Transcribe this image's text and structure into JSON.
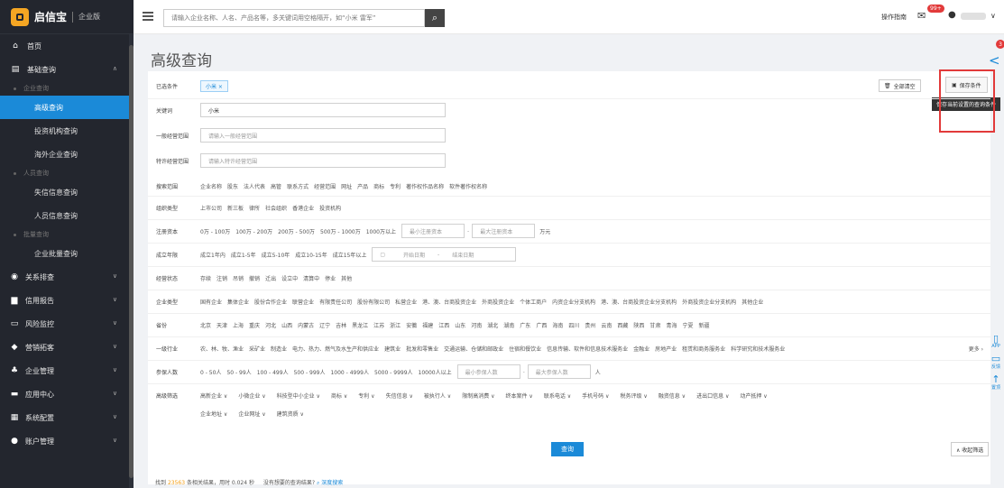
{
  "sidebar": {
    "logo_text": "启信宝",
    "logo_sub": "企业版",
    "home": "首页",
    "basic_query": "基础查询",
    "group_enterprise": "企业查询",
    "advanced_query": "高级查询",
    "investor_query": "投资机构查询",
    "overseas_query": "海外企业查询",
    "group_person": "人员查询",
    "dishonest_query": "失信信息查询",
    "person_query": "人员信息查询",
    "group_batch": "批量查询",
    "batch_query": "企业批量查询",
    "relation": "关系排查",
    "credit_report": "信用报告",
    "risk_monitor": "风险监控",
    "marketing": "营销拓客",
    "enterprise_manage": "企业管理",
    "app_center": "应用中心",
    "system_config": "系统配置",
    "account_manage": "账户管理"
  },
  "topbar": {
    "search_placeholder": "请输入企业名称、人名、产品名等，多关键词用空格隔开，如“小米 雷军”",
    "guide": "操作指南",
    "mail_badge": "99+"
  },
  "page": {
    "title": "高级查询",
    "share_badge": "3"
  },
  "form": {
    "selected_label": "已选条件",
    "selected_chip": "小米 ×",
    "clear_label": "全部清空",
    "save_label": "保存条件",
    "tooltip": "保存当前设置的查询条件",
    "keyword_label": "关键词",
    "keyword_value": "小米",
    "general_scope_label": "一般经营范围",
    "general_scope_placeholder": "请输入一般经营范围",
    "licensed_scope_label": "特许经营范围",
    "licensed_scope_placeholder": "请输入特许经营范围",
    "search_range_label": "搜索范围",
    "search_range": [
      "企业名称",
      "股东",
      "法人代表",
      "高管",
      "联系方式",
      "经营范围",
      "网址",
      "产品",
      "商标",
      "专利",
      "著作权作品名称",
      "软件著作权名称"
    ],
    "org_type_label": "组织类型",
    "org_type": [
      "上市公司",
      "新三板",
      "律所",
      "社会组织",
      "香港企业",
      "投资机构"
    ],
    "capital_label": "注册资本",
    "capital": [
      "0万 - 100万",
      "100万 - 200万",
      "200万 - 500万",
      "500万 - 1000万",
      "1000万以上"
    ],
    "capital_min": "最小注册资本",
    "capital_max": "最大注册资本",
    "capital_unit": "万元",
    "year_label": "成立年限",
    "year": [
      "成立1年内",
      "成立1-5年",
      "成立5-10年",
      "成立10-15年",
      "成立15年以上"
    ],
    "start_date": "开始日期",
    "end_date": "结束日期",
    "status_label": "经营状态",
    "status": [
      "存续",
      "注销",
      "吊销",
      "撤销",
      "迁出",
      "设立中",
      "清算中",
      "停业",
      "其他"
    ],
    "ent_type_label": "企业类型",
    "ent_type": [
      "国有企业",
      "集体企业",
      "股份合作企业",
      "联营企业",
      "有限责任公司",
      "股份有限公司",
      "私营企业",
      "港、澳、台商投资企业",
      "外商投资企业",
      "个体工商户",
      "内资企业分支机构",
      "港、澳、台商投资企业分支机构",
      "外商投资企业分支机构",
      "其他企业"
    ],
    "province_label": "省份",
    "province": [
      "北京",
      "天津",
      "上海",
      "重庆",
      "河北",
      "山西",
      "内蒙古",
      "辽宁",
      "吉林",
      "黑龙江",
      "江苏",
      "浙江",
      "安徽",
      "福建",
      "江西",
      "山东",
      "河南",
      "湖北",
      "湖南",
      "广东",
      "广西",
      "海南",
      "四川",
      "贵州",
      "云南",
      "西藏",
      "陕西",
      "甘肃",
      "青海",
      "宁夏",
      "新疆"
    ],
    "industry_label": "一级行业",
    "industry": [
      "农、林、牧、渔业",
      "采矿业",
      "制造业",
      "电力、热力、燃气及水生产和供应业",
      "建筑业",
      "批发和零售业",
      "交通运输、仓储和邮政业",
      "住宿和餐饮业",
      "信息传输、软件和信息技术服务业",
      "金融业",
      "房地产业",
      "租赁和商务服务业",
      "科学研究和技术服务业"
    ],
    "more": "更多 ›",
    "staff_label": "参保人数",
    "staff": [
      "0 - 50人",
      "50 - 99人",
      "100 - 499人",
      "500 - 999人",
      "1000 - 4999人",
      "5000 - 9999人",
      "10000人以上"
    ],
    "staff_min": "最小参保人数",
    "staff_max": "最大参保人数",
    "staff_unit": "人",
    "advanced_label": "高级筛选",
    "advanced_row1": [
      "高新企业 ∨",
      "小微企业 ∨",
      "科技型中小企业 ∨",
      "商标 ∨",
      "专利 ∨",
      "失信信息 ∨",
      "被执行人 ∨",
      "限制高消费 ∨",
      "终本案件 ∨",
      "联系电话 ∨",
      "手机号码 ∨",
      "税务评级 ∨",
      "融资信息 ∨",
      "进出口信息 ∨",
      "动产抵押 ∨"
    ],
    "advanced_row2": [
      "企业地址 ∨",
      "企业网址 ∨",
      "建筑资质 ∨"
    ],
    "query_btn": "查询",
    "collapse_btn": "∧ 收起筛选"
  },
  "result": {
    "prefix": "找到",
    "count": "23563",
    "middle": "条相关结果，用时 0.024 秒",
    "suggest": "没有想要的查询结果?",
    "deep": "深度搜索"
  },
  "floatbar": {
    "app": "APP",
    "feedback": "反馈",
    "top": "置顶"
  }
}
